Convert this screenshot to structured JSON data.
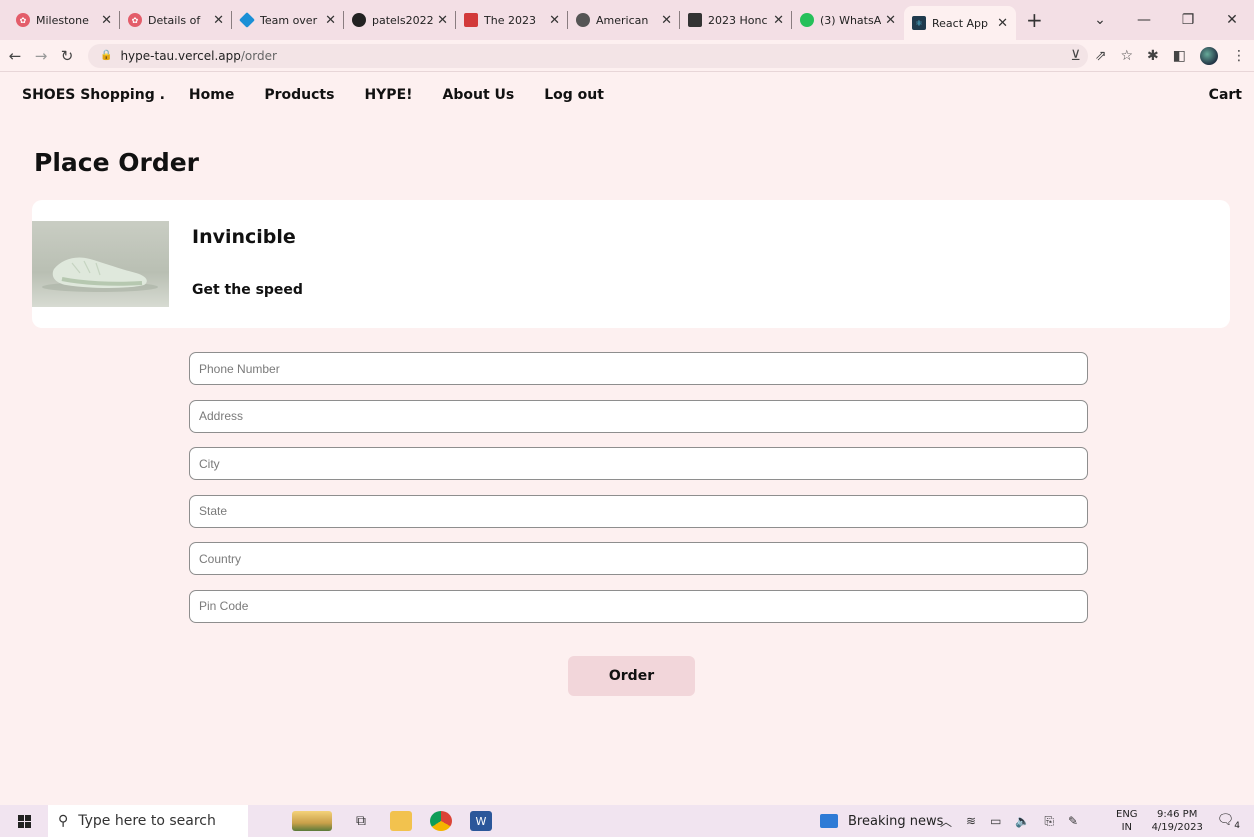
{
  "browser": {
    "tabs": [
      {
        "title": "Milestone",
        "color": "#e35d6a"
      },
      {
        "title": "Details of",
        "color": "#e35d6a"
      },
      {
        "title": "Team over",
        "color": "#1a8fd6"
      },
      {
        "title": "patels2022",
        "color": "#222222"
      },
      {
        "title": "The 2023",
        "color": "#d23a3a"
      },
      {
        "title": "American",
        "color": "#555555"
      },
      {
        "title": "2023 Honc",
        "color": "#333333"
      },
      {
        "title": "(3) WhatsA",
        "color": "#25c05a"
      },
      {
        "title": "React App",
        "color": "#1f3a4d"
      }
    ],
    "url_host": "hype-tau.vercel.app",
    "url_path": "/order"
  },
  "nav": {
    "brand": "SHOES Shopping .",
    "links": [
      "Home",
      "Products",
      "HYPE!",
      "About Us",
      "Log out"
    ],
    "cart": "Cart"
  },
  "page": {
    "title": "Place Order"
  },
  "product": {
    "name": "Invincible",
    "description": "Get the speed"
  },
  "form": {
    "fields": [
      {
        "placeholder": "Phone Number",
        "value": ""
      },
      {
        "placeholder": "Address",
        "value": ""
      },
      {
        "placeholder": "City",
        "value": ""
      },
      {
        "placeholder": "State",
        "value": ""
      },
      {
        "placeholder": "Country",
        "value": ""
      },
      {
        "placeholder": "Pin Code",
        "value": ""
      }
    ],
    "submit_label": "Order"
  },
  "taskbar": {
    "search_placeholder": "Type here to search",
    "news": "Breaking news",
    "lang_line1": "ENG",
    "lang_line2": "IN",
    "time": "9:46 PM",
    "date": "4/19/2023",
    "notifications": "4"
  }
}
